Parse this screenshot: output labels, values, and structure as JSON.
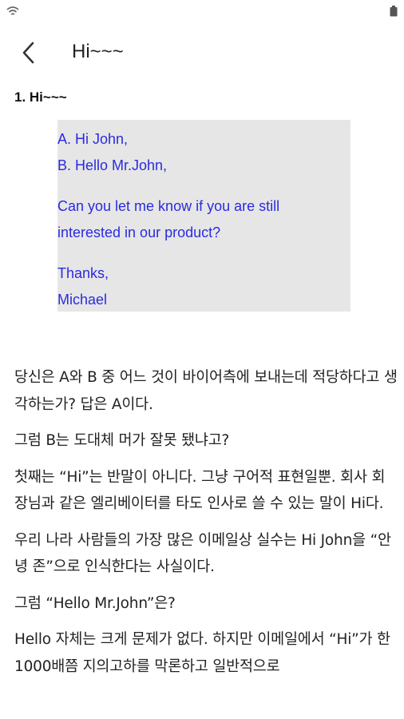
{
  "status": {
    "wifi_icon": "wifi-icon",
    "battery_icon": "battery-icon"
  },
  "header": {
    "back_icon": "chevron-left-icon",
    "title": "Hi~~~"
  },
  "section": {
    "heading": "1. Hi~~~"
  },
  "email": {
    "line_a": "A. Hi John,",
    "line_b": "B. Hello Mr.John,",
    "body_1": "Can you let me know if you are still",
    "body_2": "interested in our product?",
    "sign_1": "Thanks,",
    "sign_2": "Michael",
    "text_color": "#2b2be0",
    "box_color": "#e6e6e6"
  },
  "paragraphs": [
    "당신은 A와 B 중 어느 것이 바이어측에 보내는데 적당하다고 생각하는가? 답은 A이다.",
    "그럼 B는 도대체 머가 잘못 됐냐고?",
    "첫째는 “Hi”는 반말이 아니다. 그냥 구어적 표현일뿐. 회사 회장님과 같은 엘리베이터를 타도 인사로 쓸 수 있는 말이 Hi다.",
    "우리 나라 사람들의 가장 많은 이메일상 실수는 Hi John을 “안녕 존”으로 인식한다는 사실이다.",
    "그럼 “Hello Mr.John”은?",
    "Hello 자체는 크게 문제가 없다. 하지만 이메일에서 “Hi”가 한 1000배쯤 지의고하를 막론하고 일반적으로"
  ]
}
